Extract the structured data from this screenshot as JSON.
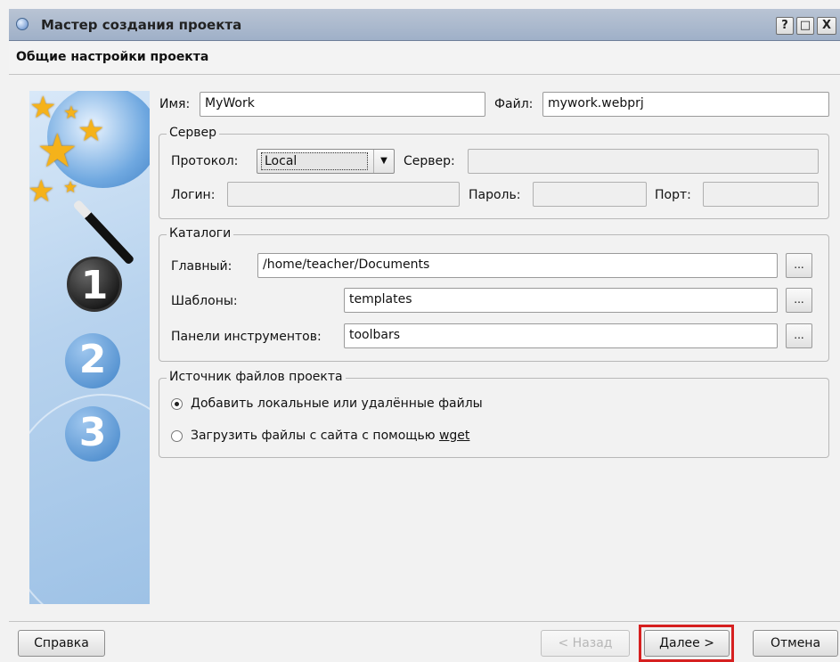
{
  "window": {
    "title": "Мастер создания проекта",
    "controls": {
      "help": "?",
      "maximize": "□",
      "close": "X"
    }
  },
  "page": {
    "subtitle": "Общие настройки проекта"
  },
  "side_art": {
    "steps": [
      "1",
      "2",
      "3"
    ]
  },
  "name_row": {
    "name_label": "Имя:",
    "name_value": "MyWork",
    "file_label": "Файл:",
    "file_value": "mywork.webprj"
  },
  "server": {
    "legend": "Сервер",
    "protocol_label": "Протокол:",
    "protocol_value": "Local",
    "server_label": "Сервер:",
    "server_value": "",
    "login_label": "Логин:",
    "login_value": "",
    "password_label": "Пароль:",
    "password_value": "",
    "port_label": "Порт:",
    "port_value": ""
  },
  "catalogs": {
    "legend": "Каталоги",
    "rows": [
      {
        "label": "Главный:",
        "value": "/home/teacher/Documents",
        "browse": "..."
      },
      {
        "label": "Шаблоны:",
        "value": "templates",
        "browse": "..."
      },
      {
        "label": "Панели инструментов:",
        "value": "toolbars",
        "browse": "..."
      }
    ]
  },
  "source": {
    "legend": "Источник файлов проекта",
    "option_add": "Добавить локальные или удалённые файлы",
    "option_wget_prefix": "Загрузить файлы с сайта с помощью ",
    "option_wget_word": "wget",
    "selected": "add"
  },
  "buttons": {
    "help": "Справка",
    "back": "< Назад",
    "next": "Далее >",
    "cancel": "Отмена"
  }
}
